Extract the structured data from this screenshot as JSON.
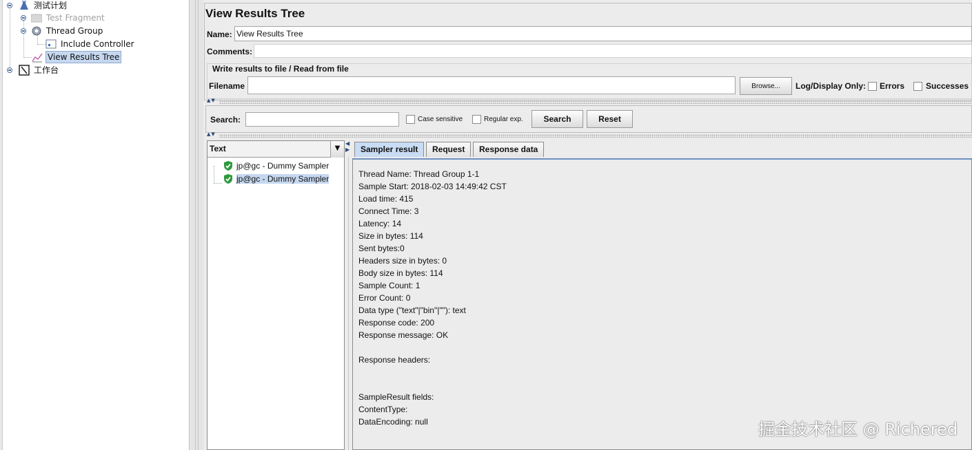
{
  "tree": {
    "nodes": [
      {
        "label": "测试计划",
        "icon": "test-plan-icon"
      },
      {
        "label": "Test Fragment",
        "icon": "test-fragment-icon",
        "disabled": true
      },
      {
        "label": "Thread Group",
        "icon": "gear-icon"
      },
      {
        "label": "Include Controller",
        "icon": "controller-icon"
      },
      {
        "label": "View Results Tree",
        "icon": "results-tree-icon",
        "selected": true
      },
      {
        "label": "工作台",
        "icon": "workbench-icon"
      }
    ]
  },
  "panel": {
    "title": "View Results Tree",
    "name_label": "Name:",
    "name_value": "View Results Tree",
    "comments_label": "Comments:",
    "write_section_label": "Write results to file / Read from file",
    "filename_label": "Filename",
    "browse_label": "Browse...",
    "log_display_label": "Log/Display Only:",
    "errors_label": "Errors",
    "successes_label": "Successes"
  },
  "search": {
    "label": "Search:",
    "case_sensitive_label": "Case sensitive",
    "regex_label": "Regular exp.",
    "search_button": "Search",
    "reset_button": "Reset"
  },
  "results": {
    "renderer": "Text",
    "items": [
      {
        "label": "jp@gc - Dummy Sampler",
        "status": "success"
      },
      {
        "label": "jp@gc - Dummy Sampler",
        "status": "success",
        "selected": true
      }
    ]
  },
  "tabs": [
    {
      "label": "Sampler result",
      "active": true
    },
    {
      "label": "Request"
    },
    {
      "label": "Response data"
    }
  ],
  "sampler_result": [
    "Thread Name: Thread Group 1-1",
    "Sample Start: 2018-02-03 14:49:42 CST",
    "Load time: 415",
    "Connect Time: 3",
    "Latency: 14",
    "Size in bytes: 114",
    "Sent bytes:0",
    "Headers size in bytes: 0",
    "Body size in bytes: 114",
    "Sample Count: 1",
    "Error Count: 0",
    "Data type (\"text\"|\"bin\"|\"\"): text",
    "Response code: 200",
    "Response message: OK",
    "",
    "Response headers:",
    "",
    "",
    "SampleResult fields:",
    "ContentType:",
    "DataEncoding: null"
  ],
  "watermark": "掘金技术社区 @ Richered",
  "colors": {
    "selection": "#c6d8f0",
    "tab_active": "#c8dcf4",
    "success_green": "#2e9a3e"
  }
}
